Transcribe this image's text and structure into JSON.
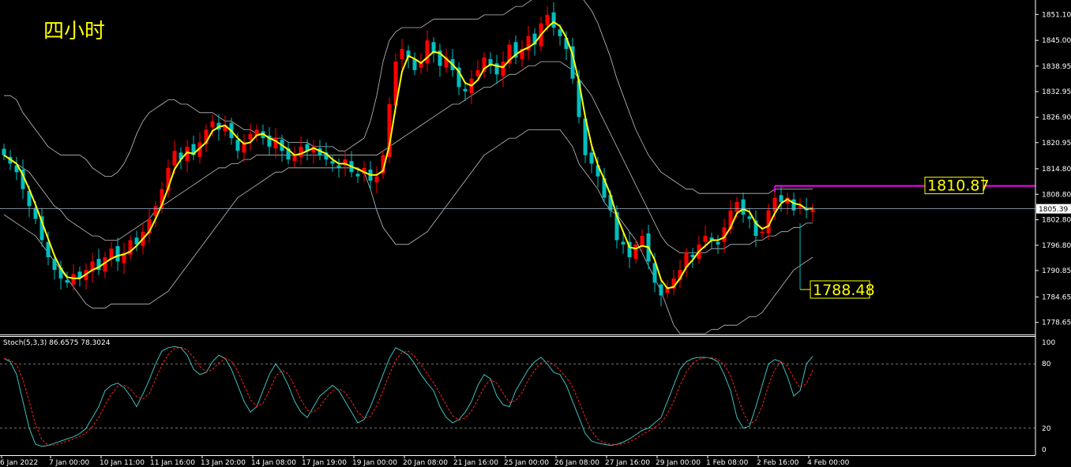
{
  "chart_data": [
    {
      "type": "candlestick",
      "title": "四小时",
      "ylim": [
        1776.0,
        1854.5
      ],
      "y_ticks": [
        "1851.10",
        "1845.00",
        "1838.95",
        "1832.95",
        "1826.90",
        "1820.95",
        "1814.80",
        "1808.80",
        "1802.80",
        "1796.80",
        "1790.85",
        "1784.65",
        "1778.65"
      ],
      "current_price": "1805.39",
      "x_ticks": [
        "6 Jan 2022",
        "7 Jan 00:00",
        "10 Jan 11:00",
        "11 Jan 16:00",
        "13 Jan 20:00",
        "14 Jan 08:00",
        "17 Jan 19:00",
        "19 Jan 00:00",
        "20 Jan 08:00",
        "21 Jan 16:00",
        "25 Jan 00:00",
        "26 Jan 08:00",
        "27 Jan 16:00",
        "29 Jan 00:00",
        "1 Feb 08:00",
        "2 Feb 16:00",
        "4 Feb 00:00"
      ],
      "annotations": [
        {
          "label": "1810.87",
          "value": 1810.87,
          "color": "#ff00ff"
        },
        {
          "label": "1788.48",
          "value": 1788.48,
          "color": "#ffff00"
        }
      ],
      "closes": [
        1818,
        1816,
        1814,
        1810,
        1806,
        1803,
        1798,
        1794,
        1791,
        1789,
        1788,
        1790,
        1789,
        1791,
        1793,
        1791,
        1794,
        1796,
        1793,
        1795,
        1798,
        1797,
        1800,
        1803,
        1806,
        1810,
        1815,
        1819,
        1817,
        1820,
        1818,
        1821,
        1824,
        1826,
        1824,
        1825,
        1822,
        1819,
        1821,
        1823,
        1824,
        1822,
        1820,
        1822,
        1819,
        1817,
        1818,
        1820,
        1819,
        1820,
        1818,
        1817,
        1816,
        1815,
        1817,
        1814,
        1813,
        1815,
        1812,
        1813,
        1818,
        1830,
        1840,
        1843,
        1841,
        1838,
        1840,
        1845,
        1842,
        1839,
        1841,
        1838,
        1834,
        1833,
        1836,
        1838,
        1841,
        1839,
        1837,
        1840,
        1844,
        1841,
        1843,
        1846,
        1844,
        1849,
        1851,
        1848,
        1846,
        1843,
        1836,
        1827,
        1818,
        1816,
        1813,
        1808,
        1805,
        1798,
        1797,
        1794,
        1797,
        1799,
        1793,
        1788,
        1785,
        1787,
        1789,
        1791,
        1795,
        1794,
        1797,
        1799,
        1798,
        1797,
        1801,
        1805,
        1807,
        1804,
        1803,
        1799,
        1800,
        1805,
        1808,
        1807,
        1808,
        1805,
        1806,
        1805,
        1805.4
      ],
      "upper_band": [
        1832,
        1832,
        1831,
        1828,
        1826,
        1824,
        1822,
        1820,
        1819,
        1818,
        1818,
        1818,
        1818,
        1817,
        1815,
        1814,
        1813,
        1813,
        1814,
        1816,
        1819,
        1823,
        1826,
        1828,
        1829,
        1830,
        1831,
        1831,
        1830,
        1830,
        1829,
        1828,
        1828,
        1828,
        1827,
        1826,
        1826,
        1825,
        1824,
        1824,
        1823,
        1823,
        1822,
        1822,
        1822,
        1821,
        1821,
        1821,
        1821,
        1820,
        1820,
        1820,
        1820,
        1819,
        1819,
        1820,
        1821,
        1822,
        1826,
        1832,
        1840,
        1845,
        1847,
        1848,
        1848,
        1848,
        1848,
        1849,
        1850,
        1850,
        1850,
        1850,
        1850,
        1850,
        1850,
        1850,
        1851,
        1851,
        1851,
        1851,
        1852,
        1853,
        1853,
        1854,
        1855,
        1856,
        1857,
        1857,
        1857,
        1857,
        1857,
        1856,
        1854,
        1852,
        1849,
        1845,
        1841,
        1836,
        1832,
        1828,
        1824,
        1821,
        1818,
        1816,
        1814,
        1813,
        1812,
        1811,
        1810,
        1810,
        1809,
        1809,
        1809,
        1809,
        1809,
        1809,
        1809,
        1809,
        1809,
        1809,
        1809,
        1809,
        1810,
        1810,
        1810,
        1810,
        1810,
        1810,
        1810
      ],
      "middle_band": [
        1818,
        1817,
        1816,
        1815,
        1814,
        1812,
        1810,
        1808,
        1806,
        1805,
        1803,
        1802,
        1801,
        1800,
        1799,
        1799,
        1798,
        1798,
        1798,
        1799,
        1800,
        1801,
        1802,
        1803,
        1805,
        1806,
        1807,
        1808,
        1809,
        1810,
        1811,
        1812,
        1813,
        1814,
        1815,
        1815,
        1816,
        1816,
        1817,
        1817,
        1818,
        1818,
        1818,
        1818,
        1818,
        1818,
        1818,
        1818,
        1818,
        1818,
        1818,
        1818,
        1818,
        1818,
        1818,
        1818,
        1818,
        1818,
        1818,
        1818,
        1819,
        1820,
        1821,
        1822,
        1823,
        1824,
        1825,
        1826,
        1827,
        1828,
        1829,
        1830,
        1830,
        1831,
        1832,
        1833,
        1834,
        1834,
        1835,
        1836,
        1837,
        1837,
        1838,
        1839,
        1839,
        1840,
        1840,
        1840,
        1840,
        1839,
        1838,
        1836,
        1834,
        1832,
        1829,
        1826,
        1823,
        1820,
        1817,
        1814,
        1811,
        1808,
        1805,
        1802,
        1799,
        1797,
        1796,
        1795,
        1795,
        1795,
        1795,
        1795,
        1796,
        1796,
        1796,
        1797,
        1797,
        1797,
        1797,
        1798,
        1798,
        1799,
        1799,
        1800,
        1800,
        1801,
        1801,
        1802,
        1802
      ],
      "lower_band": [
        1804,
        1803,
        1802,
        1801,
        1800,
        1799,
        1797,
        1795,
        1793,
        1791,
        1789,
        1787,
        1785,
        1783,
        1782,
        1782,
        1782,
        1783,
        1783,
        1783,
        1783,
        1783,
        1783,
        1783,
        1784,
        1785,
        1786,
        1788,
        1790,
        1792,
        1794,
        1796,
        1798,
        1800,
        1802,
        1804,
        1806,
        1808,
        1809,
        1810,
        1811,
        1812,
        1813,
        1814,
        1814,
        1815,
        1815,
        1815,
        1815,
        1815,
        1815,
        1815,
        1815,
        1815,
        1815,
        1815,
        1815,
        1814,
        1810,
        1805,
        1801,
        1799,
        1797,
        1797,
        1797,
        1798,
        1799,
        1800,
        1802,
        1804,
        1806,
        1808,
        1810,
        1812,
        1814,
        1816,
        1818,
        1819,
        1820,
        1821,
        1822,
        1822,
        1823,
        1824,
        1824,
        1824,
        1824,
        1824,
        1824,
        1822,
        1820,
        1816,
        1814,
        1812,
        1810,
        1807,
        1805,
        1804,
        1802,
        1800,
        1798,
        1795,
        1792,
        1789,
        1786,
        1782,
        1778,
        1776,
        1776,
        1776,
        1776,
        1776,
        1777,
        1777,
        1778,
        1778,
        1778,
        1779,
        1780,
        1780,
        1781,
        1783,
        1785,
        1787,
        1789,
        1791,
        1792,
        1793,
        1794
      ]
    },
    {
      "type": "line",
      "title": "Stoch(5,3,3) 86.6575 78.3024",
      "ylim": [
        0,
        100
      ],
      "y_ticks": [
        "100",
        "80",
        "20",
        "0"
      ],
      "levels": [
        80,
        20
      ],
      "k": [
        85,
        82,
        70,
        45,
        20,
        5,
        3,
        4,
        6,
        8,
        10,
        12,
        15,
        20,
        30,
        40,
        55,
        60,
        62,
        58,
        50,
        40,
        52,
        65,
        80,
        92,
        95,
        96,
        95,
        88,
        75,
        70,
        72,
        82,
        88,
        85,
        75,
        60,
        45,
        35,
        40,
        55,
        70,
        80,
        72,
        60,
        45,
        35,
        30,
        40,
        50,
        55,
        60,
        55,
        45,
        35,
        25,
        28,
        40,
        55,
        70,
        85,
        95,
        92,
        88,
        80,
        70,
        62,
        55,
        40,
        30,
        25,
        28,
        35,
        45,
        60,
        70,
        66,
        50,
        42,
        40,
        55,
        65,
        75,
        82,
        86,
        80,
        72,
        70,
        60,
        45,
        30,
        15,
        8,
        6,
        5,
        4,
        5,
        7,
        10,
        14,
        18,
        20,
        25,
        30,
        45,
        60,
        75,
        82,
        85,
        86,
        86,
        85,
        82,
        70,
        55,
        30,
        20,
        22,
        40,
        60,
        80,
        84,
        82,
        68,
        50,
        55,
        80,
        87
      ]
    }
  ]
}
